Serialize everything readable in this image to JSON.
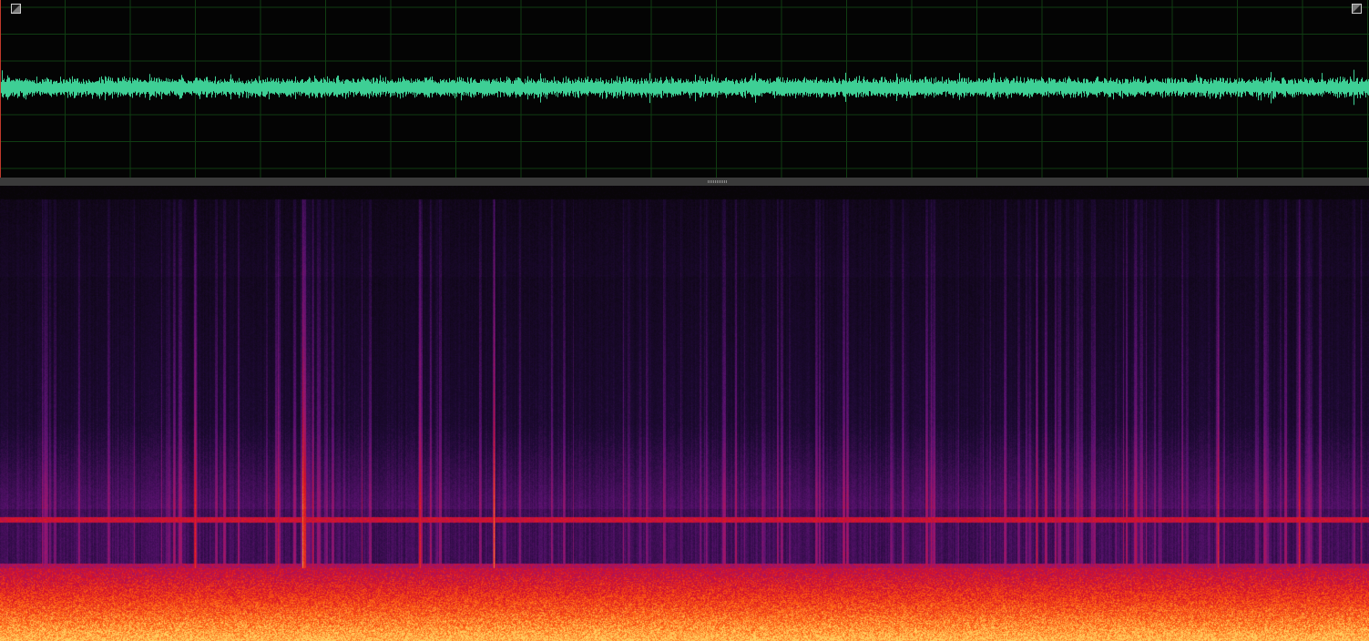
{
  "app": {
    "view": "waveform-spectrogram"
  },
  "waveform": {
    "colors": {
      "background": "#040404",
      "grid": "#0f3d12",
      "signal": "#3ecf95",
      "playhead": "#c0392b"
    },
    "zoom_left_icon": "zoom-out-corner-icon",
    "zoom_right_icon": "zoom-in-corner-icon",
    "grid_visible": true
  },
  "splitter": {
    "grip_icon": "splitter-grip-icon"
  },
  "spectrogram": {
    "colormap": [
      "#080508",
      "#1e0a35",
      "#5a1270",
      "#9a1570",
      "#d4102a",
      "#ff5a10",
      "#ffd060"
    ],
    "colors": {
      "background": "#080508",
      "hot_band": "#ff3a20",
      "bright_line": "#ff2050"
    }
  }
}
